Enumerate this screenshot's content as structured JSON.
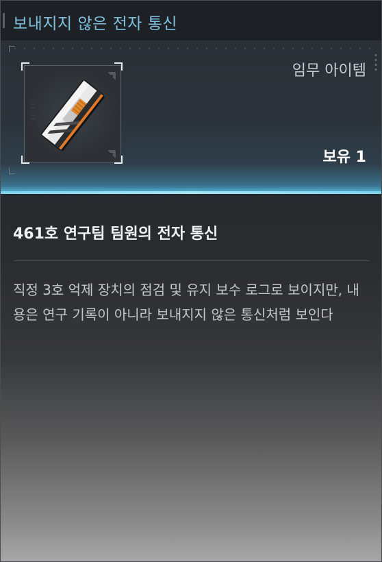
{
  "title": "보내지지 않은 전자 통신",
  "item": {
    "type": "임무 아이템",
    "hold_label": "보유 1",
    "name": "461호 연구팀 팀원의 전자 통신",
    "description": "직정 3호 억제 장치의 점검 및 유지 보수 로그로 보이지만, 내용은 연구 기록이 아니라 보내지지 않은 통신처럼 보인다",
    "icon": "electronic-device-card-icon"
  },
  "colors": {
    "title": "#7fc1df",
    "accent_line": "#7fd3ee"
  }
}
